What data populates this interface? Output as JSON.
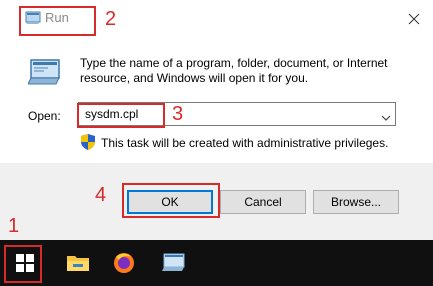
{
  "window": {
    "title": "Run",
    "description": "Type the name of a program, folder, document, or Internet resource, and Windows will open it for you.",
    "open_label": "Open:",
    "command_value": "sysdm.cpl",
    "admin_notice": "This task will be created with administrative privileges.",
    "buttons": {
      "ok": "OK",
      "cancel": "Cancel",
      "browse": "Browse..."
    }
  },
  "taskbar": {
    "items": [
      "start-button",
      "file-explorer",
      "firefox",
      "run-app"
    ]
  },
  "annotations": {
    "step1": "1",
    "step2": "2",
    "step3": "3",
    "step4": "4",
    "color": "#d72b2b"
  }
}
